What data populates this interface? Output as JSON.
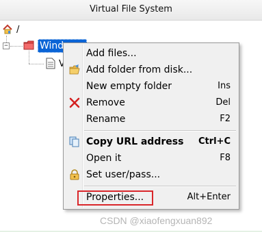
{
  "header": {
    "title": "Virtual File System"
  },
  "tree": {
    "root_label": "/",
    "selected_label": "Windows",
    "peek_text": "V"
  },
  "menu": {
    "items": [
      {
        "label": "Add files...",
        "shortcut": "",
        "icon": "none"
      },
      {
        "label": "Add folder from disk...",
        "shortcut": "",
        "icon": "open-folder-icon"
      },
      {
        "label": "New empty folder",
        "shortcut": "Ins",
        "icon": "none"
      },
      {
        "label": "Remove",
        "shortcut": "Del",
        "icon": "red-x-icon"
      },
      {
        "label": "Rename",
        "shortcut": "F2",
        "icon": "none"
      },
      {
        "label": "Copy URL address",
        "shortcut": "Ctrl+C",
        "icon": "copy-icon",
        "bold": true
      },
      {
        "label": "Open it",
        "shortcut": "F8",
        "icon": "none"
      },
      {
        "label": "Set user/pass...",
        "shortcut": "",
        "icon": "lock-icon"
      },
      {
        "label": "Properties...",
        "shortcut": "Alt+Enter",
        "icon": "none",
        "highlighted": true
      }
    ]
  },
  "watermark": "CSDN @xiaofengxuan892",
  "colors": {
    "selection": "#0a64d6",
    "highlight_box": "#d9262a",
    "menu_bg": "#f0f0f0"
  }
}
